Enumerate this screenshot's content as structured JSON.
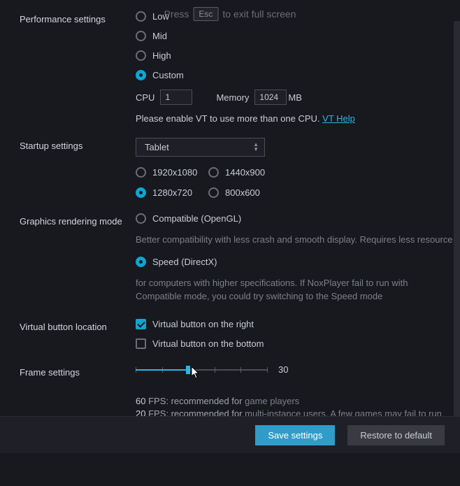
{
  "fullscreen_notice": {
    "prefix": "Press",
    "key": "Esc",
    "suffix": "to exit full screen"
  },
  "performance": {
    "label": "Performance settings",
    "options": {
      "low": "Low",
      "mid": "Mid",
      "high": "High",
      "custom": "Custom"
    },
    "selected": "custom",
    "cpu_label": "CPU",
    "cpu_value": "1",
    "mem_label": "Memory",
    "mem_value": "1024",
    "mem_unit": "MB",
    "vt_hint": "Please enable VT to use more than one CPU.",
    "vt_link": "VT Help"
  },
  "startup": {
    "label": "Startup settings",
    "device": "Tablet",
    "resolutions": {
      "r1920": "1920x1080",
      "r1440": "1440x900",
      "r1280": "1280x720",
      "r800": "800x600"
    },
    "selected": "r1280"
  },
  "graphics": {
    "label": "Graphics rendering mode",
    "compat": "Compatible (OpenGL)",
    "compat_desc": "Better compatibility with less crash and smooth display. Requires less resource",
    "speed": "Speed (DirectX)",
    "speed_desc": "for computers with higher specifications. If NoxPlayer fail to run with Compatible mode, you could try switching to the Speed mode",
    "selected": "speed"
  },
  "vbutton": {
    "label": "Virtual button location",
    "right": "Virtual button on the right",
    "right_checked": true,
    "bottom": "Virtual button on the bottom",
    "bottom_checked": false
  },
  "frame": {
    "label": "Frame settings",
    "value": 30,
    "min": 10,
    "max": 60,
    "slider_percent": 40,
    "ticks": [
      0,
      20,
      40,
      60,
      80,
      100
    ],
    "note1_prefix": "60",
    "note1_color": "FPS: recommended for",
    "note1_tail": "game players",
    "note2_prefix": "20",
    "note2_color": "FPS: recommended for",
    "note2_tail": "multi-instance users. A few games may fail to run properly."
  },
  "footer": {
    "save": "Save settings",
    "restore": "Restore to default"
  }
}
